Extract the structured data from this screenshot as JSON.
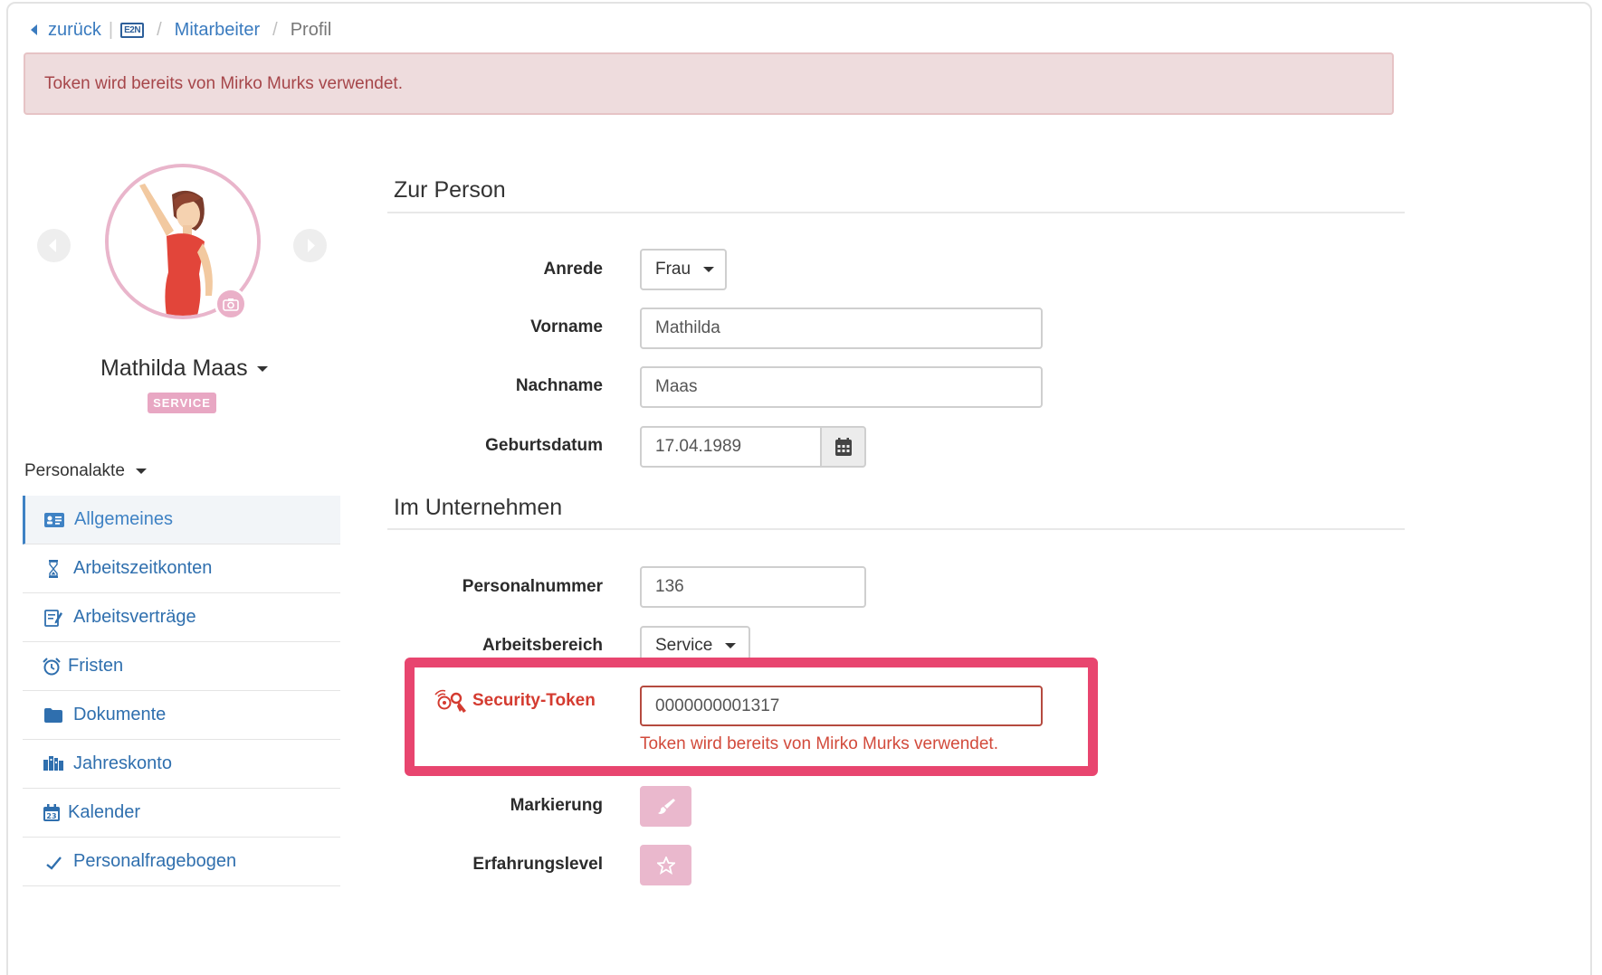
{
  "breadcrumb": {
    "back_label": "zurück",
    "logo_text": "E2N",
    "items": [
      "Mitarbeiter",
      "Profil"
    ]
  },
  "alert": {
    "message": "Token wird bereits von Mirko Murks verwendet."
  },
  "profile": {
    "name": "Mathilda Maas",
    "role_badge": "SERVICE"
  },
  "personalakte": {
    "label": "Personalakte",
    "items": [
      {
        "label": "Allgemeines",
        "icon": "id-card-icon",
        "active": true
      },
      {
        "label": "Arbeitszeitkonten",
        "icon": "hourglass-icon",
        "active": false
      },
      {
        "label": "Arbeitsverträge",
        "icon": "contract-edit-icon",
        "active": false
      },
      {
        "label": "Fristen",
        "icon": "alarm-clock-icon",
        "active": false
      },
      {
        "label": "Dokumente",
        "icon": "folder-icon",
        "active": false
      },
      {
        "label": "Jahreskonto",
        "icon": "year-account-icon",
        "active": false
      },
      {
        "label": "Kalender",
        "icon": "calendar-icon",
        "active": false
      },
      {
        "label": "Personalfragebogen",
        "icon": "questionnaire-icon",
        "active": false
      }
    ]
  },
  "sections": {
    "person_title": "Zur Person",
    "company_title": "Im Unternehmen"
  },
  "form": {
    "anrede": {
      "label": "Anrede",
      "value": "Frau"
    },
    "vorname": {
      "label": "Vorname",
      "value": "Mathilda"
    },
    "nachname": {
      "label": "Nachname",
      "value": "Maas"
    },
    "geburtsdatum": {
      "label": "Geburtsdatum",
      "value": "17.04.1989"
    },
    "personalnummer": {
      "label": "Personalnummer",
      "value": "136"
    },
    "arbeitsbereich": {
      "label": "Arbeitsbereich",
      "value": "Service"
    },
    "security_token": {
      "label": "Security-Token",
      "value": "0000000001317",
      "error": "Token wird bereits von Mirko Murks verwendet."
    },
    "markierung": {
      "label": "Markierung"
    },
    "erfahrungslevel": {
      "label": "Erfahrungslevel"
    }
  },
  "colors": {
    "link": "#3a7bbf",
    "alert_bg": "#eedcdd",
    "alert_text": "#a6464a",
    "error": "#d24a3b",
    "highlight": "#e8456f",
    "pink_accent": "#eab8cd"
  }
}
